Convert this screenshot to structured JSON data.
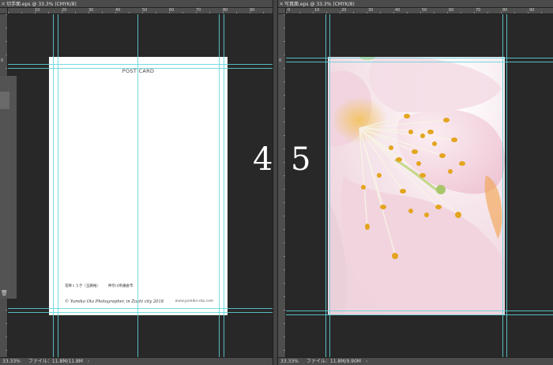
{
  "left_document": {
    "tab_title": "切手面.eps @ 33.3% (CMYK/8)",
    "ruler_marks": [
      "10",
      "20",
      "30",
      "40",
      "50",
      "60",
      "70",
      "80",
      "90",
      "100"
    ],
    "ruler_v_marks": [
      "0"
    ],
    "zoom": "33.33%",
    "file_label": "ファイル：11.8M/11.8M",
    "card": {
      "title": "POST CARD",
      "photographer_jp": "花降くうき（玉鋼裕）",
      "city_jp": "神奈川県鎌倉市",
      "copyright": "© Yumiko Ota Photographer, in Zushi city 2018",
      "url": "www.yumiko-ota.com"
    }
  },
  "right_document": {
    "tab_title": "写真面.eps @ 33.3% (CMYK/8)",
    "ruler_marks": [
      "0",
      "10",
      "20",
      "30",
      "40",
      "50",
      "60",
      "70",
      "80",
      "90",
      "100"
    ],
    "ruler_v_marks": [
      "0"
    ],
    "zoom": "33.33%",
    "file_label": "ファイル：11.8M/9.90M"
  },
  "page_numbers": {
    "left": "4",
    "right": "5"
  },
  "icons": {
    "close": "close-icon",
    "trash": "trash-icon",
    "status_arrow": "chevron-right-icon"
  },
  "colors": {
    "guide": "#5fd4dc",
    "pasteboard": "#282828",
    "chrome": "#4b4b4b"
  }
}
